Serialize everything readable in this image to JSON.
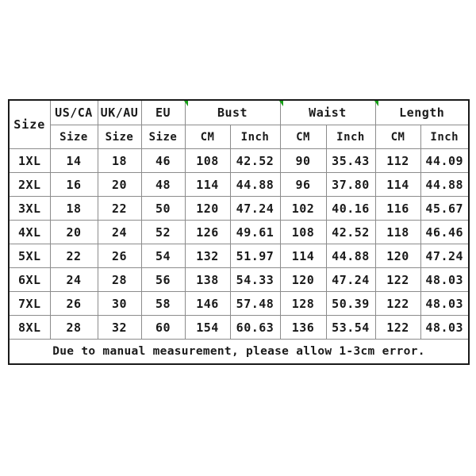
{
  "table": {
    "corner_label": "Size",
    "group_headers": [
      {
        "label": "US/CA",
        "span": 1
      },
      {
        "label": "UK/AU",
        "span": 1
      },
      {
        "label": "EU",
        "span": 1
      },
      {
        "label": "Bust",
        "span": 2
      },
      {
        "label": "Waist",
        "span": 2
      },
      {
        "label": "Length",
        "span": 2
      }
    ],
    "sub_headers": [
      "Size",
      "Size",
      "Size",
      "CM",
      "Inch",
      "CM",
      "Inch",
      "CM",
      "Inch"
    ],
    "rows": [
      {
        "size": "1XL",
        "us_ca": "14",
        "uk_au": "18",
        "eu": "46",
        "bust_cm": "108",
        "bust_inch": "42.52",
        "waist_cm": "90",
        "waist_inch": "35.43",
        "length_cm": "112",
        "length_inch": "44.09"
      },
      {
        "size": "2XL",
        "us_ca": "16",
        "uk_au": "20",
        "eu": "48",
        "bust_cm": "114",
        "bust_inch": "44.88",
        "waist_cm": "96",
        "waist_inch": "37.80",
        "length_cm": "114",
        "length_inch": "44.88"
      },
      {
        "size": "3XL",
        "us_ca": "18",
        "uk_au": "22",
        "eu": "50",
        "bust_cm": "120",
        "bust_inch": "47.24",
        "waist_cm": "102",
        "waist_inch": "40.16",
        "length_cm": "116",
        "length_inch": "45.67"
      },
      {
        "size": "4XL",
        "us_ca": "20",
        "uk_au": "24",
        "eu": "52",
        "bust_cm": "126",
        "bust_inch": "49.61",
        "waist_cm": "108",
        "waist_inch": "42.52",
        "length_cm": "118",
        "length_inch": "46.46"
      },
      {
        "size": "5XL",
        "us_ca": "22",
        "uk_au": "26",
        "eu": "54",
        "bust_cm": "132",
        "bust_inch": "51.97",
        "waist_cm": "114",
        "waist_inch": "44.88",
        "length_cm": "120",
        "length_inch": "47.24"
      },
      {
        "size": "6XL",
        "us_ca": "24",
        "uk_au": "28",
        "eu": "56",
        "bust_cm": "138",
        "bust_inch": "54.33",
        "waist_cm": "120",
        "waist_inch": "47.24",
        "length_cm": "122",
        "length_inch": "48.03"
      },
      {
        "size": "7XL",
        "us_ca": "26",
        "uk_au": "30",
        "eu": "58",
        "bust_cm": "146",
        "bust_inch": "57.48",
        "waist_cm": "128",
        "waist_inch": "50.39",
        "length_cm": "122",
        "length_inch": "48.03"
      },
      {
        "size": "8XL",
        "us_ca": "28",
        "uk_au": "32",
        "eu": "60",
        "bust_cm": "154",
        "bust_inch": "60.63",
        "waist_cm": "136",
        "waist_inch": "53.54",
        "length_cm": "122",
        "length_inch": "48.03"
      }
    ],
    "footnote": "Due to manual measurement, please allow 1-3cm error.",
    "footnote_color": "#ff0000"
  }
}
